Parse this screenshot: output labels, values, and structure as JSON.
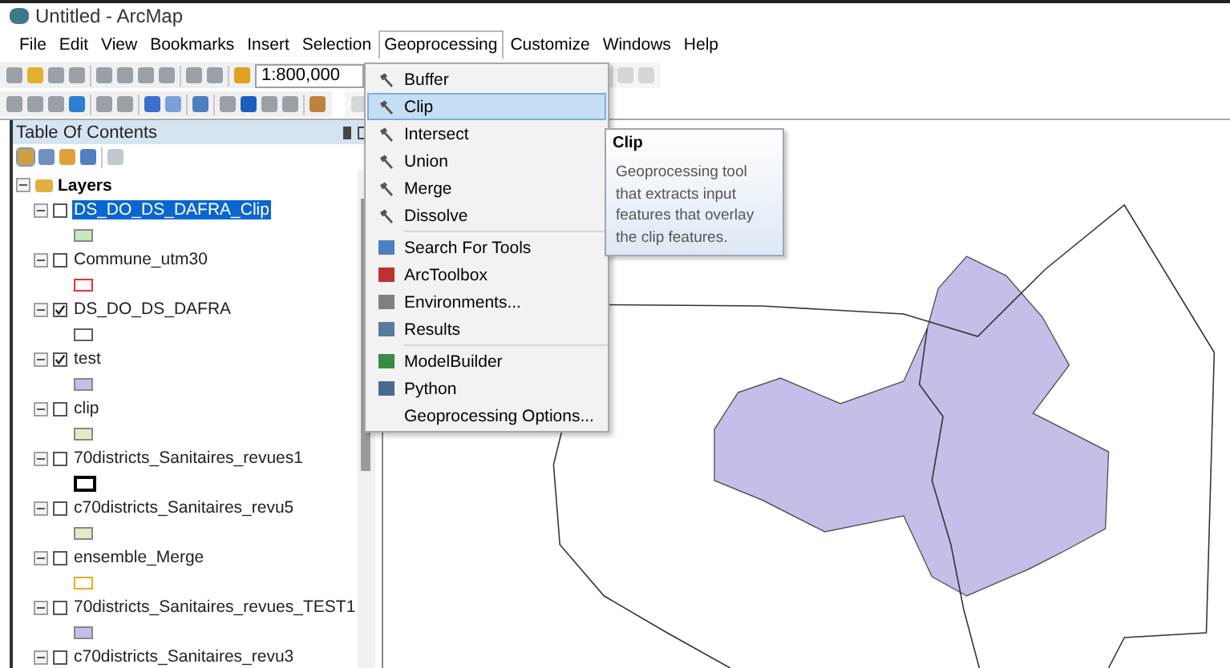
{
  "window": {
    "title": "Untitled - ArcMap"
  },
  "menu_bar": [
    {
      "label": "File",
      "selected": false
    },
    {
      "label": "Edit",
      "selected": false
    },
    {
      "label": "View",
      "selected": false
    },
    {
      "label": "Bookmarks",
      "selected": false
    },
    {
      "label": "Insert",
      "selected": false
    },
    {
      "label": "Selection",
      "selected": false
    },
    {
      "label": "Geoprocessing",
      "selected": true
    },
    {
      "label": "Customize",
      "selected": false
    },
    {
      "label": "Windows",
      "selected": false
    },
    {
      "label": "Help",
      "selected": false
    }
  ],
  "toolbar": {
    "scale": "1:800,000"
  },
  "table_of_contents": {
    "title": "Table Of Contents",
    "root": {
      "label": "Layers",
      "expanded": true,
      "children": [
        {
          "label": "DS_DO_DS_DAFRA_Clip",
          "checked": false,
          "selected": true,
          "expanded": true,
          "kind": "fill",
          "color": "#c8e8c0"
        },
        {
          "label": "Commune_utm30",
          "checked": false,
          "selected": false,
          "expanded": true,
          "kind": "outline",
          "color": "#e83030"
        },
        {
          "label": "DS_DO_DS_DAFRA",
          "checked": true,
          "selected": false,
          "expanded": true,
          "kind": "outline",
          "color": "#606060"
        },
        {
          "label": "test",
          "checked": true,
          "selected": false,
          "expanded": true,
          "kind": "fill",
          "color": "#c4bee8"
        },
        {
          "label": "clip",
          "checked": false,
          "selected": false,
          "expanded": true,
          "kind": "fill",
          "color": "#e6e8c6"
        },
        {
          "label": "70districts_Sanitaires_revues1",
          "checked": false,
          "selected": false,
          "expanded": true,
          "kind": "thick",
          "color": "#000000"
        },
        {
          "label": "c70districts_Sanitaires_revu5",
          "checked": false,
          "selected": false,
          "expanded": true,
          "kind": "fill",
          "color": "#e6e8c6"
        },
        {
          "label": "ensemble_Merge",
          "checked": false,
          "selected": false,
          "expanded": true,
          "kind": "outline",
          "color": "#f0a820"
        },
        {
          "label": "70districts_Sanitaires_revues_TEST1",
          "checked": false,
          "selected": false,
          "expanded": true,
          "kind": "fill",
          "color": "#c4bee8"
        },
        {
          "label": "c70districts_Sanitaires_revu3",
          "checked": false,
          "selected": false,
          "expanded": true,
          "kind": "none"
        }
      ]
    }
  },
  "geoprocessing_menu": {
    "groups": [
      [
        {
          "label": "Buffer",
          "selected": false
        },
        {
          "label": "Clip",
          "selected": true
        },
        {
          "label": "Intersect",
          "selected": false
        },
        {
          "label": "Union",
          "selected": false
        },
        {
          "label": "Merge",
          "selected": false
        },
        {
          "label": "Dissolve",
          "selected": false
        }
      ],
      [
        {
          "label": "Search For Tools",
          "selected": false
        },
        {
          "label": "ArcToolbox",
          "selected": false
        },
        {
          "label": "Environments...",
          "selected": false
        },
        {
          "label": "Results",
          "selected": false
        }
      ],
      [
        {
          "label": "ModelBuilder",
          "selected": false
        },
        {
          "label": "Python",
          "selected": false
        },
        {
          "label": "Geoprocessing Options...",
          "selected": false
        }
      ]
    ]
  },
  "tooltip": {
    "title": "Clip",
    "text": "Geoprocessing tool that extracts input features that overlay the clip features."
  }
}
